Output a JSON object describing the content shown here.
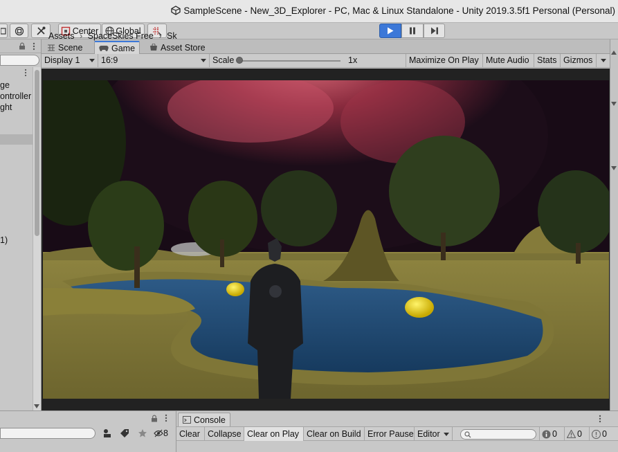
{
  "window": {
    "title": "SampleScene - New_3D_Explorer - PC, Mac & Linux Standalone - Unity 2019.3.5f1 Personal (Personal)"
  },
  "toolbar": {
    "pivot_label": "Center",
    "space_label": "Global"
  },
  "hierarchy": {
    "items": [
      "ge",
      "ontroller",
      "ght",
      "",
      "",
      "",
      "",
      "",
      "",
      "",
      "",
      "",
      "",
      "",
      "1)"
    ]
  },
  "tabs": {
    "scene": "Scene",
    "game": "Game",
    "asset_store": "Asset Store"
  },
  "game_bar": {
    "display": "Display 1",
    "aspect": "16:9",
    "scale_label": "Scale",
    "scale_value": "1x",
    "maximize": "Maximize On Play",
    "mute": "Mute Audio",
    "stats": "Stats",
    "gizmos": "Gizmos"
  },
  "console": {
    "tab_label": "Console",
    "clear": "Clear",
    "collapse": "Collapse",
    "clear_on_play": "Clear on Play",
    "clear_on_build": "Clear on Build",
    "error_pause": "Error Pause",
    "editor": "Editor",
    "log_count": "0",
    "warning_count": "0",
    "error_count": "0"
  },
  "project": {
    "hidden_count": "8",
    "breadcrumb": [
      "Assets",
      "SpaceSkies Free",
      "Sk"
    ]
  },
  "colors": {
    "accent": "#3c78d8",
    "panel": "#c8c8c8"
  }
}
